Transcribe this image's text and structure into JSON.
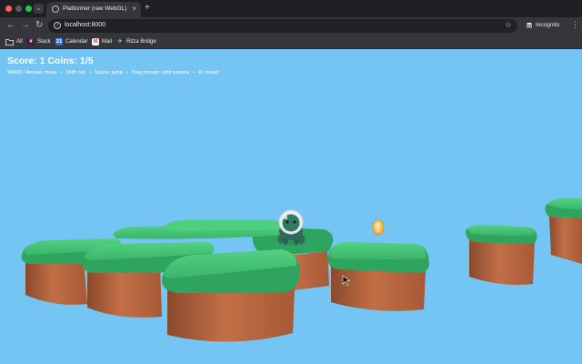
{
  "browser": {
    "tab_title": "Platformer (raw WebGL)",
    "tab_close_glyph": "×",
    "new_tab_glyph": "+",
    "url": "localhost:8000",
    "incognito_label": "Incognito",
    "bookmarks": [
      {
        "label": "All",
        "icon": "folder-icon"
      },
      {
        "label": "Slack",
        "icon": "slack-icon"
      },
      {
        "label": "Calendar",
        "icon": "calendar-icon"
      },
      {
        "label": "Mail",
        "icon": "gmail-icon"
      },
      {
        "label": "Ritza Bridge",
        "icon": "ritza-bridge-icon"
      }
    ]
  },
  "hud": {
    "score_text": "Score: 1 Coins: 1/5",
    "controls": [
      "WASD / Arrows: move",
      "Shift: run",
      "Space: jump",
      "Drag mouse: orbit camera",
      "R: restart"
    ],
    "separator": "•"
  },
  "colors": {
    "sky": "#74c4f4",
    "grass": "#48c97a",
    "grass_dark": "#2fa45e",
    "dirt": "#c26f46",
    "dirt_dark": "#8a4a2c",
    "coin": "#f7b53b",
    "character_body": "#2e6b59",
    "helmet": "#e9edf0"
  }
}
